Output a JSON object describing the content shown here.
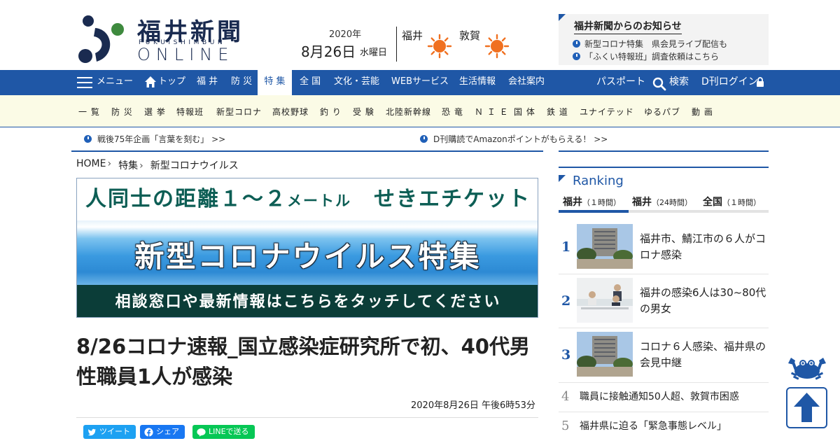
{
  "header": {
    "logo_title": "福井新聞",
    "logo_sub": "FUKUISHIMBUN",
    "logo_online": "ONLINE",
    "date_year": "2020年",
    "date_day": "8月26日",
    "date_weekday": "水曜日",
    "weather": [
      {
        "city": "福井",
        "icon": "sun-icon"
      },
      {
        "city": "敦賀",
        "icon": "sun-icon"
      }
    ],
    "notice": {
      "title": "福井新聞からのお知らせ",
      "items": [
        "新型コロナ特集　県会見ライブ配信も",
        "「ふくい特報班」調査依頼はこちら"
      ]
    }
  },
  "gnav": {
    "menu": "メニュー",
    "items": [
      "トップ",
      "福 井",
      "防 災",
      "特 集",
      "全 国",
      "文化・芸能",
      "WEBサービス",
      "生活情報",
      "会社案内"
    ],
    "active": "特 集",
    "passport": "パスポート",
    "search": "検索",
    "login": "D刊ログイン"
  },
  "snav": {
    "items": [
      "一 覧",
      "防 災",
      "選 挙",
      "特報班",
      "新型コロナ",
      "高校野球",
      "釣 り",
      "受 験",
      "北陸新幹線",
      "恐 竜",
      "Ｎ Ｉ Ｅ",
      "国 体",
      "鉄 道",
      "ユナイテッド",
      "ゆるパブ",
      "動 画"
    ]
  },
  "ticker": [
    "戦後75年企画「言葉を刻む」 >>",
    "D刊購読でAmazonポイントがもらえる！ >>"
  ],
  "breadcrumb": [
    "HOME",
    "特集",
    "新型コロナウイルス"
  ],
  "banner": {
    "top_a": "人同士の距離１～２",
    "top_b": "メートル",
    "top_c": "　せきエチケット",
    "middle": "新型コロナウイルス特集",
    "bottom": "相談窓口や最新情報はこちらをタッチしてください"
  },
  "article": {
    "headline": "8/26コロナ速報_国立感染症研究所で初、40代男性職員1人が感染",
    "published": "2020年8月26日 午後6時53分"
  },
  "share": {
    "tweet": "ツイート",
    "facebook": "シェア",
    "line": "LINEで送る"
  },
  "ranking": {
    "title": "Ranking",
    "tabs": [
      {
        "name": "福井",
        "period": "（１時間）"
      },
      {
        "name": "福井",
        "period": "（24時間）"
      },
      {
        "name": "全国",
        "period": "（１時間）"
      }
    ],
    "items": [
      {
        "rank": "1",
        "title": "福井市、鯖江市の６人がコロナ感染"
      },
      {
        "rank": "2",
        "title": "福井の感染6人は30~80代の男女"
      },
      {
        "rank": "3",
        "title": "コロナ６人感染、福井県の会見中継"
      },
      {
        "rank": "4",
        "title": "職員に接触通知50人超、敦賀市困惑"
      },
      {
        "rank": "5",
        "title": "福井県に迫る「緊急事態レベル」"
      }
    ]
  },
  "colors": {
    "brand_blue": "#1f57a6",
    "subnav_bg": "#fbfbe6",
    "banner_green": "#0b3d38",
    "sun_orange": "#f07020"
  }
}
